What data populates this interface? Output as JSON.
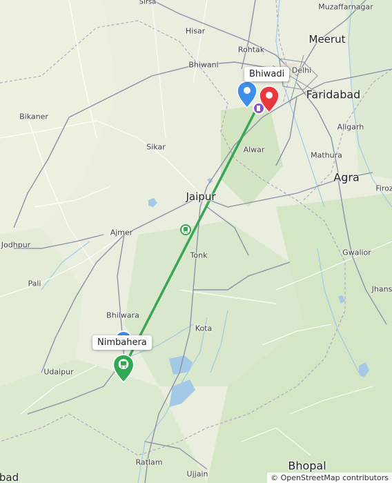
{
  "cities": [
    {
      "name": "Sirsa"
    },
    {
      "name": "Muzaffarnagar"
    },
    {
      "name": "Hisar"
    },
    {
      "name": "Meerut"
    },
    {
      "name": "Rohtak"
    },
    {
      "name": "Bhiwani"
    },
    {
      "name": "Delhi"
    },
    {
      "name": "Faridabad"
    },
    {
      "name": "Bikaner"
    },
    {
      "name": "Aligarh"
    },
    {
      "name": "Sikar"
    },
    {
      "name": "Alwar"
    },
    {
      "name": "Mathura"
    },
    {
      "name": "Agra"
    },
    {
      "name": "Jaipur"
    },
    {
      "name": "Firoz"
    },
    {
      "name": "Ajmer"
    },
    {
      "name": "Jodhpur"
    },
    {
      "name": "Tonk"
    },
    {
      "name": "Gwalior"
    },
    {
      "name": "Pali"
    },
    {
      "name": "Jhansi"
    },
    {
      "name": "Bhilwara"
    },
    {
      "name": "Kota"
    },
    {
      "name": "Udaipur"
    },
    {
      "name": "Bhopal"
    },
    {
      "name": "Ratlam"
    },
    {
      "name": "Ujjain"
    },
    {
      "name": "bad"
    }
  ],
  "route": {
    "origin": {
      "label": "Bhiwadi",
      "pin_color": "#e8383d"
    },
    "destination": {
      "label": "Nimbahera",
      "pin_color": "#32a852"
    },
    "waypoint_pin_color": "#3d8ee8",
    "route_color": "#3aa655",
    "mode_icon": "train-icon"
  },
  "attribution": "© OpenStreetMap contributors"
}
